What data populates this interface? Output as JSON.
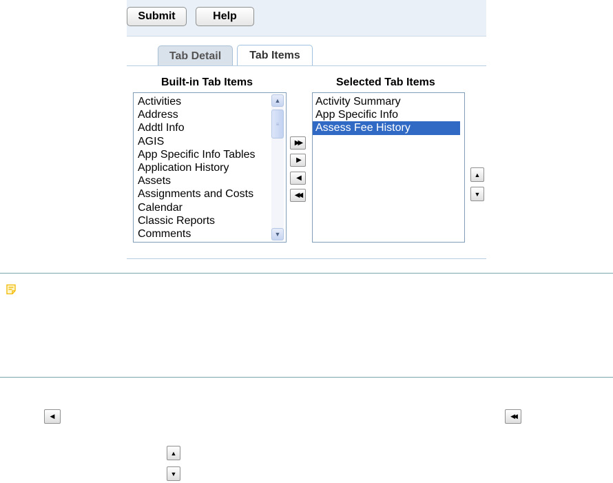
{
  "toolbar": {
    "submit_label": "Submit",
    "help_label": "Help"
  },
  "tabs": [
    {
      "label": "Tab Detail",
      "active": false
    },
    {
      "label": "Tab Items",
      "active": true
    }
  ],
  "builtin": {
    "title": "Built-in Tab Items",
    "items": [
      "Activities",
      "Address",
      "Addtl Info",
      "AGIS",
      "App Specific Info Tables",
      "Application History",
      "Assets",
      "Assignments and Costs",
      "Calendar",
      "Classic Reports",
      "Comments"
    ]
  },
  "selected": {
    "title": "Selected Tab Items",
    "items": [
      "Activity Summary",
      "App Specific Info",
      "Assess Fee History"
    ],
    "selected_item": "Assess Fee History"
  },
  "move_buttons": {
    "add_all": "▶▶",
    "add": "▶",
    "remove": "◀",
    "remove_all": "◀◀"
  },
  "order_buttons": {
    "up": "▲",
    "down": "▼"
  },
  "scrollbar": {
    "up": "▲",
    "down": "▼",
    "grip": "≡"
  },
  "colors": {
    "selection": "#316ac5",
    "panel": "#e9f0f8",
    "note_icon": "#f2b800"
  },
  "icons": {
    "note": "note-icon"
  }
}
